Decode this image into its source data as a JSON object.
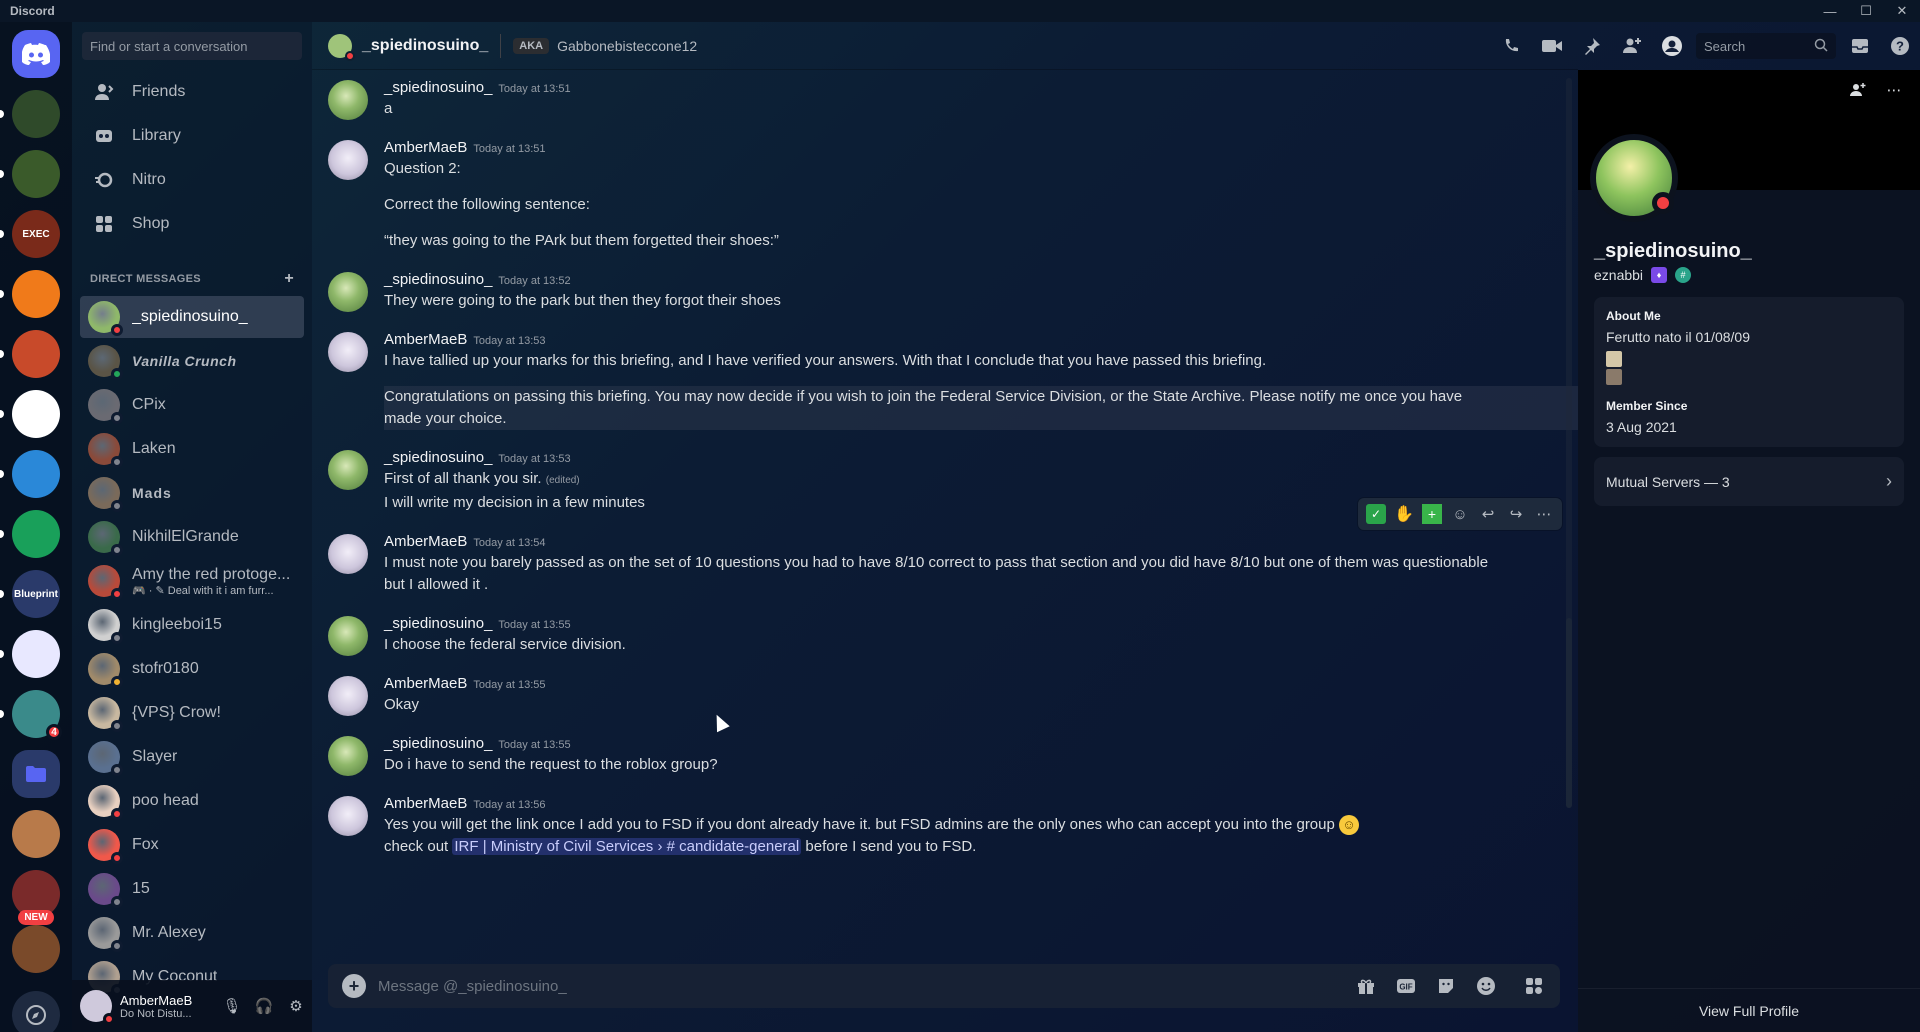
{
  "app": {
    "title": "Discord"
  },
  "window": {
    "minimize": "—",
    "maximize": "☐",
    "close": "✕"
  },
  "dm_sidebar": {
    "search_placeholder": "Find or start a conversation",
    "nav": [
      {
        "label": "Friends",
        "icon": "friends-icon"
      },
      {
        "label": "Library",
        "icon": "library-icon"
      },
      {
        "label": "Nitro",
        "icon": "nitro-icon"
      },
      {
        "label": "Shop",
        "icon": "shop-icon"
      }
    ],
    "header": "DIRECT MESSAGES",
    "header_plus": "+",
    "dms": [
      {
        "name": "_spiedinosuino_",
        "status": "dnd",
        "color": "#8fb86a"
      },
      {
        "name": "Vanilla Crunch",
        "status": "online",
        "color": "#5a5446"
      },
      {
        "name": "CPix",
        "status": "offline",
        "color": "#6a6a72"
      },
      {
        "name": "Laken",
        "status": "offline",
        "color": "#8a4a3a"
      },
      {
        "name": "Mads",
        "status": "offline",
        "color": "#7a6a5a"
      },
      {
        "name": "NikhilElGrande",
        "status": "offline",
        "color": "#3a6a4a"
      },
      {
        "name": "Amy the red protoge...",
        "sub": "🎮 · ✎ Deal with it i am furr...",
        "status": "dnd",
        "color": "#b84a3a"
      },
      {
        "name": "kingleeboi15",
        "status": "offline",
        "color": "#d0d0d0"
      },
      {
        "name": "stofr0180",
        "status": "idle",
        "color": "#a08a6a"
      },
      {
        "name": "{VPS} Crow!",
        "status": "offline",
        "color": "#c8b8a0"
      },
      {
        "name": "Slayer",
        "status": "offline",
        "color": "#5a7090"
      },
      {
        "name": "poo head",
        "status": "dnd",
        "color": "#e8d0c0"
      },
      {
        "name": "Fox",
        "status": "dnd",
        "color": "#f0584a"
      },
      {
        "name": "15",
        "status": "offline",
        "color": "#6a4a8a"
      },
      {
        "name": "Mr. Alexey",
        "status": "offline",
        "color": "#9a9a9a"
      },
      {
        "name": "My Coconut",
        "status": "offline",
        "color": "#b0a090"
      }
    ]
  },
  "user_panel": {
    "name": "AmberMaeB",
    "status": "Do Not Distu...",
    "mic_icon": "🎙",
    "headphones_icon": "🎧",
    "settings_icon": "⚙"
  },
  "servers": [
    {
      "label": "",
      "color": "#5865f2",
      "kind": "home"
    },
    {
      "label": "",
      "color": "#2f4a2a"
    },
    {
      "label": "",
      "color": "#3a5a2a"
    },
    {
      "label": "EXEC",
      "color": "#7a2a1a"
    },
    {
      "label": "",
      "color": "#f07a1a"
    },
    {
      "label": "",
      "color": "#c84a2a"
    },
    {
      "label": "",
      "color": "#ffffff"
    },
    {
      "label": "",
      "color": "#2a88d8"
    },
    {
      "label": "",
      "color": "#19a05a"
    },
    {
      "label": "Blueprint",
      "color": "#2a3a6a"
    },
    {
      "label": "",
      "color": "#e8e8ff"
    },
    {
      "label": "",
      "color": "#3a8a8a",
      "badge": "4"
    },
    {
      "label": "",
      "color": "#5865f2",
      "kind": "folder"
    },
    {
      "label": "",
      "color": "#b87a4a"
    },
    {
      "label": "",
      "color": "#7a2a2a"
    },
    {
      "label": "",
      "color": "#7a4a2a"
    }
  ],
  "new_pill": "NEW",
  "chat": {
    "header": {
      "name": "_spiedinosuino_",
      "aka_label": "AKA",
      "aka_name": "Gabbonebisteccone12",
      "search_placeholder": "Search"
    },
    "messages": [
      {
        "author": "_spiedinosuino_",
        "avatar": "spied",
        "time": "Today at 13:51",
        "lines": [
          "a"
        ]
      },
      {
        "author": "AmberMaeB",
        "avatar": "amber",
        "time": "Today at 13:51",
        "lines": [
          "Question 2:",
          "",
          "Correct the following sentence:",
          "",
          "“they was going to the PArk but them forgetted their shoes:”"
        ]
      },
      {
        "author": "_spiedinosuino_",
        "avatar": "spied",
        "time": "Today at 13:52",
        "lines": [
          "They were going to the park but then they forgot their shoes"
        ]
      },
      {
        "author": "AmberMaeB",
        "avatar": "amber",
        "time": "Today at 13:53",
        "lines": [
          "I have tallied up your marks for this briefing, and I have verified your answers. With that I conclude that you have passed this briefing.",
          "",
          "Congratulations on passing this briefing. You may now decide if you wish to join the Federal Service Division, or the State Archive. Please notify me once you have",
          "made your choice."
        ]
      },
      {
        "author": "_spiedinosuino_",
        "avatar": "spied",
        "time": "Today at 13:53",
        "lines": [
          "First of all thank you sir.",
          "I will write my decision in a few minutes"
        ],
        "edited": "(edited)"
      },
      {
        "author": "AmberMaeB",
        "avatar": "amber",
        "time": "Today at 13:54",
        "lines": [
          "I must note you barely passed as on the set of 10 questions you had to have 8/10 correct to pass that section and you did have 8/10 but one of them was questionable",
          "but I allowed it ."
        ]
      },
      {
        "author": "_spiedinosuino_",
        "avatar": "spied",
        "time": "Today at 13:55",
        "lines": [
          "I choose the federal service division."
        ]
      },
      {
        "author": "AmberMaeB",
        "avatar": "amber",
        "time": "Today at 13:55",
        "lines": [
          "Okay"
        ]
      },
      {
        "author": "_spiedinosuino_",
        "avatar": "spied",
        "time": "Today at 13:55",
        "lines": [
          "Do i have to send the request to the roblox group?"
        ]
      },
      {
        "author": "AmberMaeB",
        "avatar": "amber",
        "time": "Today at 13:56",
        "lines": [
          "Yes you will get the link once I add you to FSD if you dont already have it. but FSD admins are the only ones who can accept you into the group"
        ],
        "line2_prefix": "check out ",
        "mention": "IRF | Ministry of Civil Services › # candidate-general",
        "line2_suffix": " before I send you to FSD."
      }
    ],
    "composer_placeholder": "Message @_spiedinosuino_"
  },
  "profile": {
    "name": "_spiedinosuino_",
    "username": "eznabbi",
    "about_title": "About Me",
    "about_text": "Ferutto nato il 01/08/09",
    "member_since_title": "Member Since",
    "member_since": "3 Aug 2021",
    "mutual_servers": "Mutual Servers — 3",
    "view_full": "View Full Profile"
  },
  "colors": {
    "accent": "#5865f2",
    "dnd": "#f23f42",
    "online": "#23a55a",
    "idle": "#f0b232"
  }
}
